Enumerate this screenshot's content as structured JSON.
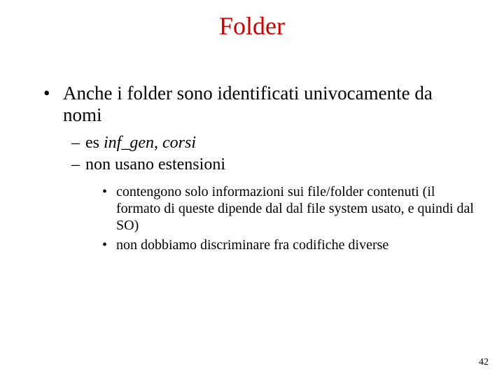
{
  "title": "Folder",
  "bullets": {
    "lvl1": "Anche i folder sono identificati univocamente da nomi",
    "lvl2a_prefix": "es ",
    "lvl2a_italic": "inf_gen, corsi",
    "lvl2b": "non usano estensioni",
    "lvl3a": "contengono solo informazioni sui file/folder contenuti (il formato di queste dipende dal dal file system usato, e quindi dal SO)",
    "lvl3b": "non dobbiamo discriminare fra codifiche diverse"
  },
  "page_number": "42"
}
